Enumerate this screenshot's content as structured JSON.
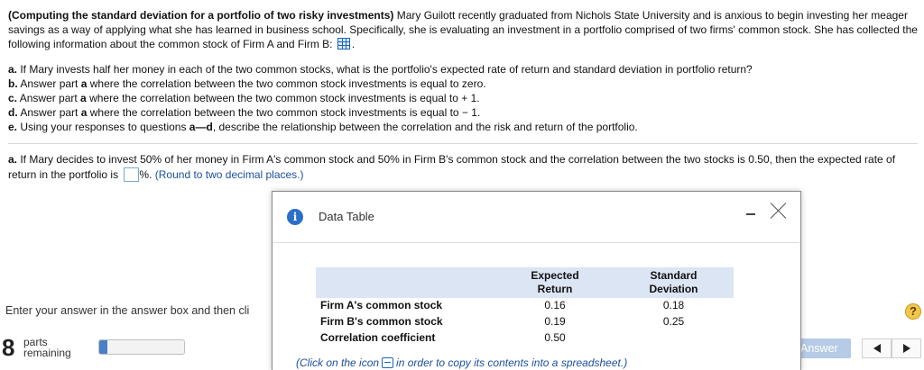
{
  "problem": {
    "title": "(Computing the standard deviation for a portfolio of two risky investments)",
    "intro": " Mary Guilott recently graduated from Nichols State University and is anxious to begin investing her meager savings as a way of applying what she has learned in business school. Specifically, she is evaluating an investment in a portfolio comprised of two firms' common stock. She has collected the following information about the common stock of Firm A and Firm B:",
    "intro_end": ".",
    "parts": [
      {
        "label": "a.",
        "text": " If Mary invests half her money in each of the two common stocks, what is the portfolio's expected rate of return and standard deviation in portfolio return?"
      },
      {
        "label": "b.",
        "text": " Answer part ",
        "bold": "a",
        "tail": " where the correlation between the two common stock investments is equal to zero."
      },
      {
        "label": "c.",
        "text": " Answer part ",
        "bold": "a",
        "tail": " where the correlation between the two common stock investments is equal to  + 1."
      },
      {
        "label": "d.",
        "text": " Answer part ",
        "bold": "a",
        "tail": " where the correlation between the two common stock investments is equal to  − 1."
      },
      {
        "label": "e.",
        "text": " Using your responses to questions ",
        "bold": "a—d",
        "tail": ", describe the relationship between the correlation and the risk and return of the portfolio."
      }
    ]
  },
  "question": {
    "label": "a.",
    "text": " If Mary decides to invest 50% of her money in Firm A's common stock and 50% in Firm B's common stock and the correlation between the two stocks is 0.50, then the expected rate of return in the portfolio is ",
    "unit": "%.",
    "hint": "(Round to two decimal places.)"
  },
  "footer": {
    "instruction": "Enter your answer in the answer box and then cli",
    "parts_count": "8",
    "parts_label_1": "parts",
    "parts_label_2": "remaining",
    "progress_fraction": 0.1,
    "answer_button": "Answer",
    "help": "?"
  },
  "dialog": {
    "title": "Data Table",
    "info_glyph": "i",
    "headers": {
      "col1_a": "Expected",
      "col1_b": "Return",
      "col2_a": "Standard",
      "col2_b": "Deviation"
    },
    "rows": [
      {
        "label": "Firm A's common stock",
        "v1": "0.16",
        "v2": "0.18"
      },
      {
        "label": "Firm B's common stock",
        "v1": "0.19",
        "v2": "0.25"
      },
      {
        "label": "Correlation coefficient",
        "v1": "0.50",
        "v2": ""
      }
    ],
    "copy_note_before": "(Click on the icon",
    "copy_note_after": "in order to copy its contents into a spreadsheet.)"
  },
  "colors": {
    "accent": "#1b4f9c",
    "header_bg": "#dce5f3",
    "progress": "#4a7fc7",
    "answer_button": "#b5cbe6",
    "help": "#f2c84b"
  }
}
